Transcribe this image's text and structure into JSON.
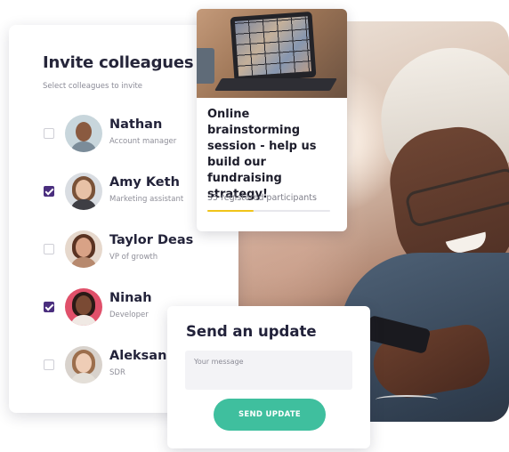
{
  "invite": {
    "title": "Invite colleagues",
    "subtitle": "Select colleagues to invite",
    "colleagues": [
      {
        "name": "Nathan",
        "role": "Account manager",
        "checked": false
      },
      {
        "name": "Amy Keth",
        "role": "Marketing assistant",
        "checked": true
      },
      {
        "name": "Taylor Deas",
        "role": "VP of growth",
        "checked": false
      },
      {
        "name": "Ninah",
        "role": "Developer",
        "checked": true
      },
      {
        "name": "Aleksandra",
        "role": "SDR",
        "checked": false
      }
    ]
  },
  "event": {
    "title": "Online brainstorming session - help us build our fundraising strategy!",
    "participants": "35 registered participants",
    "progress_fraction": 0.38
  },
  "update": {
    "title": "Send an update",
    "message_placeholder": "Your message",
    "send_label": "SEND UPDATE"
  },
  "colors": {
    "checkbox_checked": "#4a2e7e",
    "progress": "#f0c419",
    "button": "#3fbf9e"
  }
}
